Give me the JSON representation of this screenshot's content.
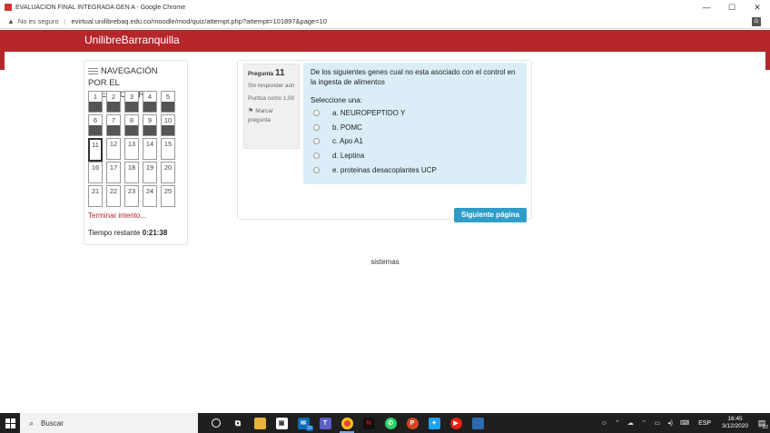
{
  "window": {
    "title": "EVALUACION FINAL INTEGRADA GEN A - Google Chrome",
    "controls": [
      "—",
      "☐",
      "✕"
    ]
  },
  "address_bar": {
    "security_label": "No es seguro",
    "url": "evirtual.unilibrebaq.edu.co/moodle/mod/quiz/attempt.php?attempt=101897&page=10"
  },
  "site": {
    "brand": "UnilibreBarranquilla",
    "brand_color": "#b5262b"
  },
  "quiz_nav": {
    "heading_line1": "NAVEGACIÓN",
    "heading_line2": "POR EL CUESTIONARIO",
    "questions": [
      {
        "label": "1",
        "answered": true
      },
      {
        "label": "2",
        "answered": true
      },
      {
        "label": "3",
        "answered": true
      },
      {
        "label": "4",
        "answered": true
      },
      {
        "label": "5",
        "answered": true
      },
      {
        "label": "6",
        "answered": true
      },
      {
        "label": "7",
        "answered": true
      },
      {
        "label": "8",
        "answered": true
      },
      {
        "label": "9",
        "answered": true
      },
      {
        "label": "10",
        "answered": true
      },
      {
        "label": "11",
        "answered": false,
        "current": true
      },
      {
        "label": "12",
        "answered": false
      },
      {
        "label": "13",
        "answered": false
      },
      {
        "label": "14",
        "answered": false
      },
      {
        "label": "15",
        "answered": false
      },
      {
        "label": "16",
        "answered": false
      },
      {
        "label": "17",
        "answered": false
      },
      {
        "label": "18",
        "answered": false
      },
      {
        "label": "19",
        "answered": false
      },
      {
        "label": "20",
        "answered": false
      },
      {
        "label": "21",
        "answered": false
      },
      {
        "label": "22",
        "answered": false
      },
      {
        "label": "23",
        "answered": false
      },
      {
        "label": "24",
        "answered": false
      },
      {
        "label": "25",
        "answered": false
      }
    ],
    "finish_link": "Terminar intento...",
    "time_label": "Tiempo restante",
    "time_value": "0:21:38"
  },
  "question": {
    "number_prefix": "Pregunta",
    "number": "11",
    "state": "Sin responder aún",
    "grade": "Puntúa como 1,00",
    "flag_label": "Marcar pregunta",
    "text": "De los siguientes genes cual no  esta asociado con el control en la ingesta de alimentos",
    "prompt": "Seleccione una:",
    "answers": [
      "a. NEUROPEPTIDO Y",
      "b. POMC",
      "c. Apo A1",
      "d. Leptina",
      "e. proteinas desacoplantes UCP"
    ],
    "next_button": "Siguiente página",
    "box_color": "#dbeef7",
    "button_color": "#2f9dc8"
  },
  "footer": {
    "text": "sistemas"
  },
  "taskbar": {
    "search_placeholder": "Buscar",
    "mail_badge": "20",
    "language": "ESP",
    "time": "16:45",
    "date": "3/12/2020",
    "notification_count": "22"
  }
}
